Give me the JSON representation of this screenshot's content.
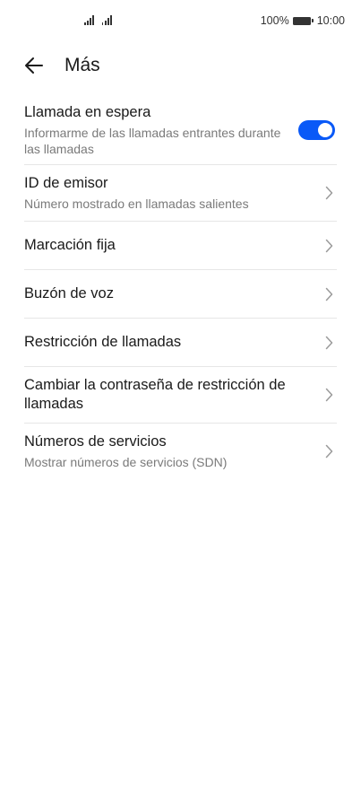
{
  "status_bar": {
    "battery_percent": "100%",
    "time": "10:00"
  },
  "header": {
    "title": "Más"
  },
  "items": [
    {
      "title": "Llamada en espera",
      "subtitle": "Informarme de las llamadas entrantes durante las llamadas",
      "control": "toggle",
      "toggle_on": true
    },
    {
      "title": "ID de emisor",
      "subtitle": "Número mostrado en llamadas salientes",
      "control": "chevron"
    },
    {
      "title": "Marcación fija",
      "control": "chevron"
    },
    {
      "title": "Buzón de voz",
      "control": "chevron"
    },
    {
      "title": "Restricción de llamadas",
      "control": "chevron"
    },
    {
      "title": "Cambiar la contraseña de restricción de llamadas",
      "control": "chevron"
    },
    {
      "title": "Números de servicios",
      "subtitle": "Mostrar números de servicios (SDN)",
      "control": "chevron"
    }
  ],
  "colors": {
    "accent": "#0a59f7",
    "text_primary": "#1a1a1a",
    "text_secondary": "#7a7a7a",
    "divider": "#e6e6e6"
  }
}
